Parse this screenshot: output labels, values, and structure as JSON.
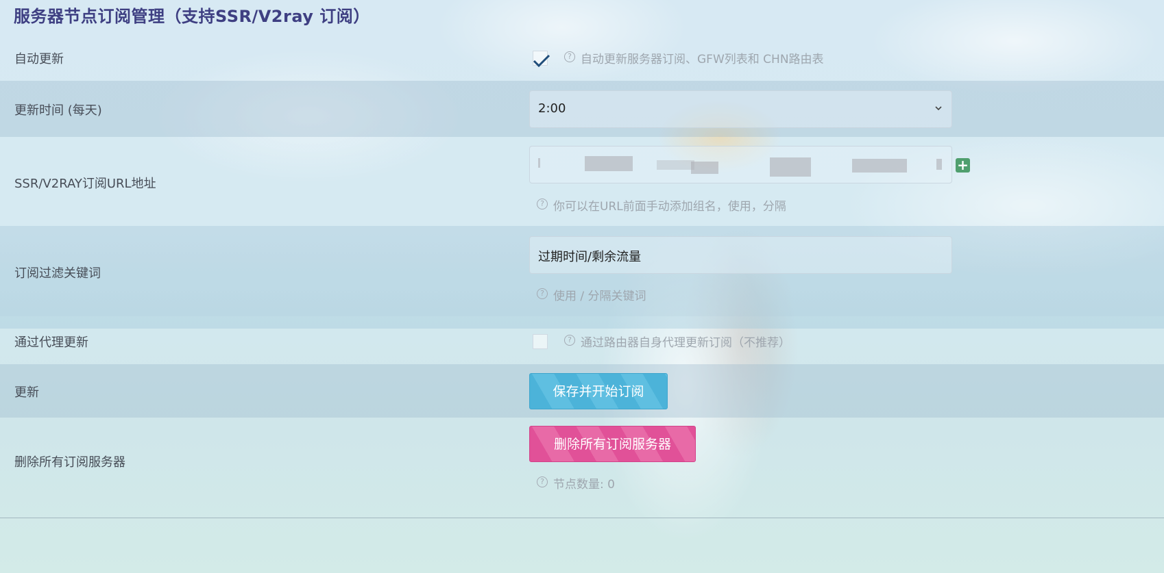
{
  "page": {
    "title": "服务器节点订阅管理（支持SSR/V2ray 订阅）"
  },
  "rows": {
    "auto_update": {
      "label": "自动更新",
      "checked": true,
      "help": "自动更新服务器订阅、GFW列表和 CHN路由表"
    },
    "update_time": {
      "label": "更新时间 (每天)",
      "selected": "2:00"
    },
    "subscribe_url": {
      "label": "SSR/V2RAY订阅URL地址",
      "value": "",
      "help": "你可以在URL前面手动添加组名，使用，分隔"
    },
    "filter_keywords": {
      "label": "订阅过滤关键词",
      "value": "过期时间/剩余流量",
      "help": "使用 / 分隔关键词"
    },
    "proxy_update": {
      "label": "通过代理更新",
      "checked": false,
      "help": "通过路由器自身代理更新订阅（不推荐）"
    },
    "update": {
      "label": "更新",
      "button": "保存并开始订阅"
    },
    "delete_all": {
      "label": "删除所有订阅服务器",
      "button": "删除所有订阅服务器",
      "help": "节点数量: 0"
    }
  },
  "icons": {
    "help": "question-circle-icon",
    "add": "plus-square-icon",
    "check": "checkmark-icon",
    "select": "chevron-down-icon"
  },
  "colors": {
    "title": "#3e3f82",
    "save_button": "#4cb3d9",
    "delete_button": "#e15198",
    "add_button": "#4f9f6e"
  }
}
